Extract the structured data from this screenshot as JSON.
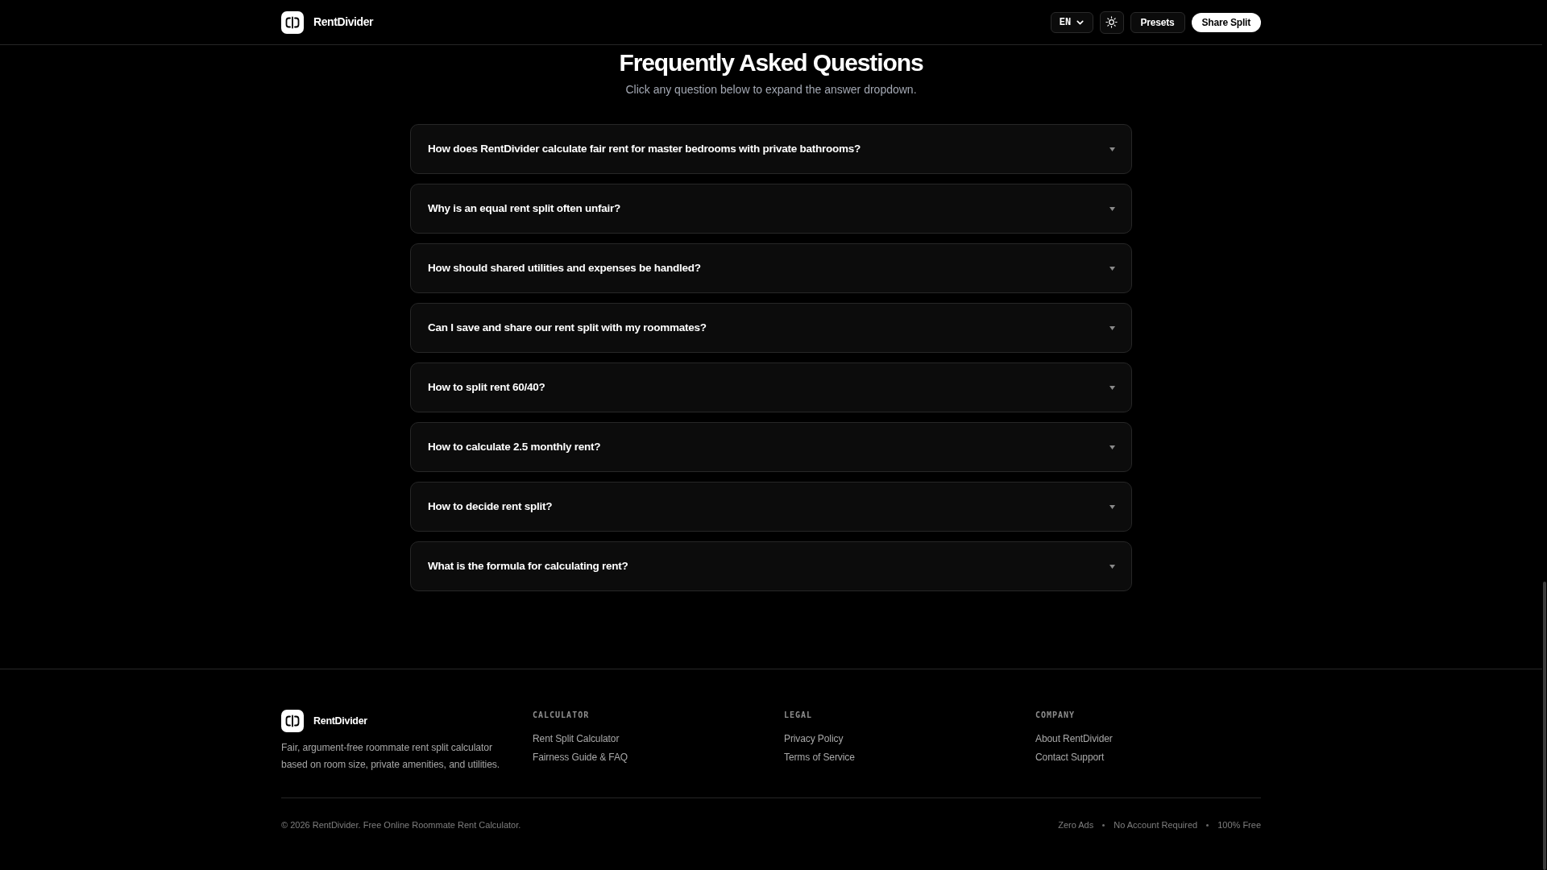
{
  "header": {
    "brand": "RentDivider",
    "language": "EN",
    "buttons": [
      {
        "label": "Presets",
        "kind": "outline"
      },
      {
        "label": "Share Split",
        "kind": "primary"
      }
    ]
  },
  "faq": {
    "title": "Frequently Asked Questions",
    "subtitle": "Click any question below to expand the answer dropdown.",
    "items": [
      {
        "question": "How does RentDivider calculate fair rent for master bedrooms with private bathrooms?",
        "expanded": false
      },
      {
        "question": "Why is an equal rent split often unfair?",
        "expanded": false
      },
      {
        "question": "How should shared utilities and expenses be handled?",
        "expanded": false
      },
      {
        "question": "Can I save and share our rent split with my roommates?",
        "expanded": false
      },
      {
        "question": "How to split rent 60/40?",
        "expanded": false
      },
      {
        "question": "How to calculate 2.5 monthly rent?",
        "expanded": false
      },
      {
        "question": "How to decide rent split?",
        "expanded": false
      },
      {
        "question": "What is the formula for calculating rent?",
        "expanded": false
      }
    ]
  },
  "footer": {
    "brand": "RentDivider",
    "description": "Fair, argument-free roommate rent split calculator based on room size, private amenities, and utilities.",
    "columns": [
      {
        "heading": "CALCULATOR",
        "links": [
          "Rent Split Calculator",
          "Fairness Guide & FAQ"
        ]
      },
      {
        "heading": "LEGAL",
        "links": [
          "Privacy Policy",
          "Terms of Service"
        ]
      },
      {
        "heading": "COMPANY",
        "links": [
          "About RentDivider",
          "Contact Support"
        ]
      }
    ],
    "copyright": "© 2026 RentDivider. Free Online Roommate Rent Calculator.",
    "highlights": [
      "Zero Ads",
      "No Account Required",
      "100% Free"
    ]
  }
}
